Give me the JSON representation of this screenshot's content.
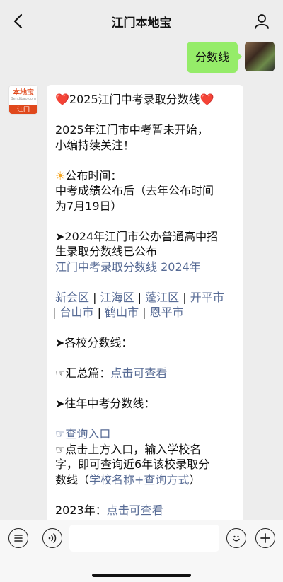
{
  "header": {
    "title": "江门本地宝"
  },
  "user_message": {
    "text": "分数线"
  },
  "bot": {
    "logo_main": "本地宝",
    "logo_sub": "Bendibao.com",
    "logo_city": "江门"
  },
  "message": {
    "heart_left": "❤️",
    "title": "2025江门中考录取分数线",
    "heart_right": "❤️",
    "line1": "2025年江门市中考暂未开始，",
    "line2": "小编持续关注！",
    "sun": "☀",
    "publish_label": "公布时间：",
    "publish_line1": "中考成绩公布后（去年公布时间",
    "publish_line2": "为7月19日）",
    "item2024_line1": "➤2024年江门市公办普通高中招",
    "item2024_line2": "生录取分数线已公布",
    "link2024": "江门中考录取分数线 2024年",
    "districts": [
      "新会区",
      "江海区",
      "蓬江区",
      "开平市",
      "台山市",
      "鹤山市",
      "恩平市"
    ],
    "sep": " | ",
    "each_school": "➤各校分数线：",
    "summary_label": "☞汇总篇：",
    "summary_link": "点击可查看",
    "past_years": "➤往年中考分数线：",
    "query_link": "☞查询入口",
    "instr_line1": "☞点击上方入口，输入学校名",
    "instr_line2": "字，即可查询近6年该校录取分",
    "instr_line3_prefix": "数线（",
    "instr_line3_link": "学校名称+查询方式",
    "instr_line3_suffix": "）",
    "y2023_label": "2023年：",
    "y2023_link": "点击可查看"
  },
  "colors": {
    "link": "#576b95",
    "bubble_user": "#95ec69",
    "accent": "#e0481c"
  },
  "icons": [
    "back-arrow-icon",
    "user-profile-icon",
    "menu-icon",
    "voice-icon",
    "emoji-icon",
    "plus-icon"
  ]
}
